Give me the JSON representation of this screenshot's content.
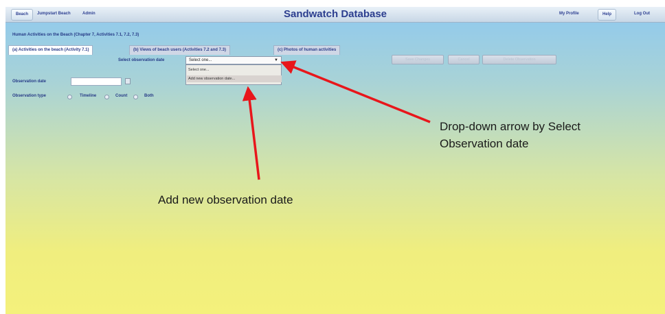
{
  "header": {
    "nav_left": [
      "Beach",
      "Jumpstart Beach",
      "Admin"
    ],
    "title": "Sandwatch Database",
    "nav_right": [
      "My Profile",
      "Help",
      "Log Out"
    ]
  },
  "section_title": "Human Activities on the Beach (Chapter 7, Activities 7.1, 7.2, 7.3)",
  "tabs": [
    {
      "label": "(a) Activities on the beach (Activity 7.1)",
      "active": true
    },
    {
      "label": "(b) Views of beach users (Activities 7.2 and 7.3)",
      "active": false
    },
    {
      "label": "(c) Photos of human activities",
      "active": false
    }
  ],
  "select_date": {
    "label": "Select observation date",
    "value": "Select one...",
    "options": [
      "Select one...",
      "Add new observation date..."
    ]
  },
  "disabled_buttons": [
    "Save Changes",
    "Cancel",
    "Delete Observation"
  ],
  "form": {
    "date_label": "Observation date",
    "type_label": "Observation type",
    "types": [
      "Timeline",
      "Count",
      "Both"
    ]
  },
  "callouts": {
    "arrow_text_line1": "Drop-down arrow by Select",
    "arrow_text_line2": "Observation date",
    "add_new_text": "Add new observation date"
  },
  "colors": {
    "arrow": "#e8161b",
    "title": "#2c3e8f"
  }
}
